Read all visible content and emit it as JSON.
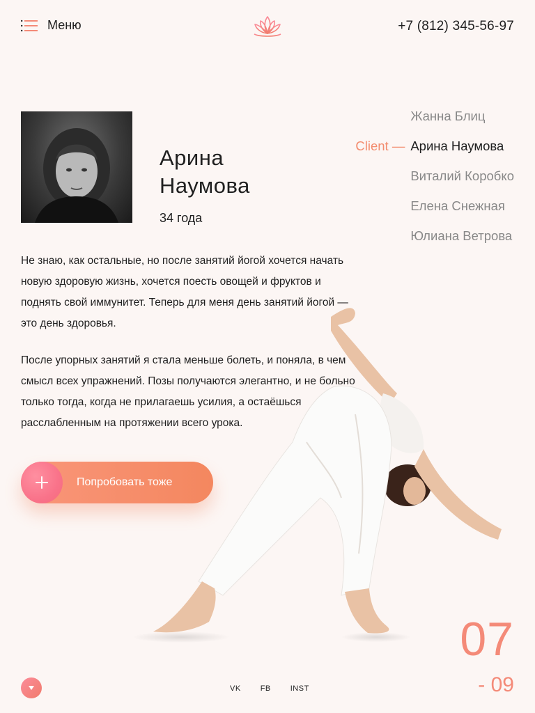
{
  "header": {
    "menu_label": "Меню",
    "phone": "+7 (812) 345-56-97",
    "logo_icon": "lotus-icon"
  },
  "profile": {
    "first_name": "Арина",
    "last_name": "Наумова",
    "age": "34 года"
  },
  "clients": {
    "tag": "Client —",
    "items": [
      {
        "name": "Жанна Блиц",
        "active": false
      },
      {
        "name": "Арина Наумова",
        "active": true
      },
      {
        "name": "Виталий Коробко",
        "active": false
      },
      {
        "name": "Елена Снежная",
        "active": false
      },
      {
        "name": "Юлиана Ветрова",
        "active": false
      }
    ]
  },
  "testimonial": {
    "paragraph_1": "Не знаю, как остальные, но после занятий йогой хочется начать новую здоровую жизнь, хочется поесть овощей и фруктов и поднять свой иммунитет. Теперь для меня день занятий йогой — это день здоровья.",
    "paragraph_2": "После упорных занятий я стала меньше болеть, и поняла, в чем смысл всех упражнений. Позы получаются элегантно, и не больно только тогда, когда не прилагаешь усилия, а остаёшься расслабленным на протяжении всего урока."
  },
  "cta": {
    "label": "Попробовать тоже",
    "icon": "plus-icon"
  },
  "footer": {
    "socials": [
      "VK",
      "FB",
      "INST"
    ],
    "slide_current": "07",
    "slide_total": "- 09",
    "scroll_icon": "chevron-down-icon"
  },
  "colors": {
    "background": "#fcf6f4",
    "accent": "#f48a78",
    "cta_gradient_start": "#f9967a",
    "cta_gradient_end": "#f4875f",
    "muted_text": "#888888"
  }
}
